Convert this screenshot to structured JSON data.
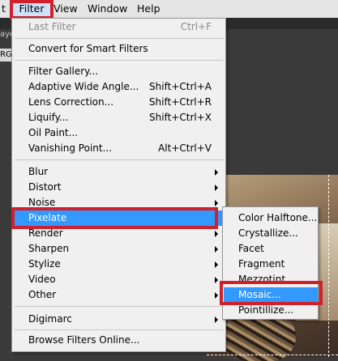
{
  "menubar": {
    "partial_left": "t",
    "filter": "Filter",
    "view": "View",
    "window": "Window",
    "help": "Help"
  },
  "workspace": {
    "tab_fragment_1": "aye",
    "tab_fragment_2": "RGI"
  },
  "filter_menu": {
    "last_filter": {
      "label": "Last Filter",
      "shortcut": "Ctrl+F"
    },
    "convert_smart": {
      "label": "Convert for Smart Filters"
    },
    "filter_gallery": {
      "label": "Filter Gallery..."
    },
    "adaptive_wide_angle": {
      "label": "Adaptive Wide Angle...",
      "shortcut": "Shift+Ctrl+A"
    },
    "lens_correction": {
      "label": "Lens Correction...",
      "shortcut": "Shift+Ctrl+R"
    },
    "liquify": {
      "label": "Liquify...",
      "shortcut": "Shift+Ctrl+X"
    },
    "oil_paint": {
      "label": "Oil Paint..."
    },
    "vanishing_point": {
      "label": "Vanishing Point...",
      "shortcut": "Alt+Ctrl+V"
    },
    "blur": {
      "label": "Blur"
    },
    "distort": {
      "label": "Distort"
    },
    "noise": {
      "label": "Noise"
    },
    "pixelate": {
      "label": "Pixelate"
    },
    "render": {
      "label": "Render"
    },
    "sharpen": {
      "label": "Sharpen"
    },
    "stylize": {
      "label": "Stylize"
    },
    "video": {
      "label": "Video"
    },
    "other": {
      "label": "Other"
    },
    "digimarc": {
      "label": "Digimarc"
    },
    "browse_online": {
      "label": "Browse Filters Online..."
    }
  },
  "pixelate_submenu": {
    "color_halftone": "Color Halftone...",
    "crystallize": "Crystallize...",
    "facet": "Facet",
    "fragment": "Fragment",
    "mezzotint": "Mezzotint...",
    "mosaic": "Mosaic...",
    "pointillize": "Pointillize..."
  },
  "colors": {
    "highlight": "#3399ff",
    "annotation_box": "#d0202c"
  }
}
